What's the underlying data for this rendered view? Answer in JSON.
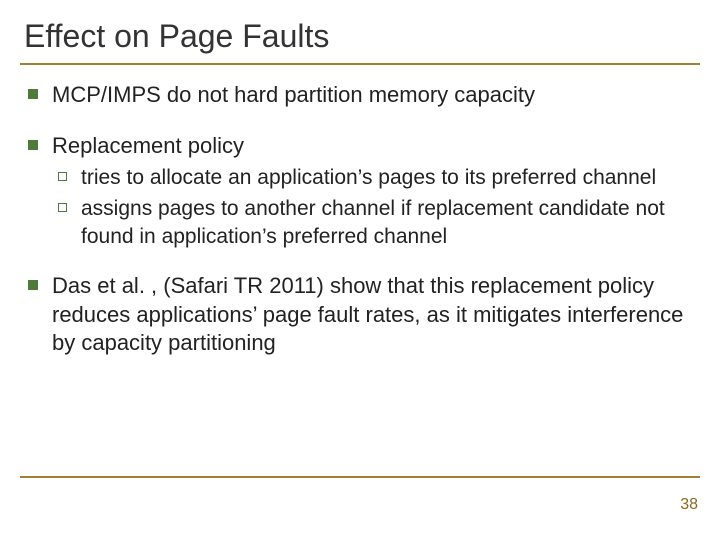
{
  "title": "Effect on Page Faults",
  "bullets": {
    "b0": "MCP/IMPS do not hard partition memory capacity",
    "b1": "Replacement policy",
    "b1_subs": {
      "s0": "tries to allocate an application’s pages to its preferred channel",
      "s1": "assigns pages to another channel if replacement candidate not found in application’s preferred channel"
    },
    "b2": "Das et al. , (Safari TR 2011) show that this replacement policy reduces applications’ page fault rates, as it mitigates interference by capacity partitioning"
  },
  "page_number": "38"
}
